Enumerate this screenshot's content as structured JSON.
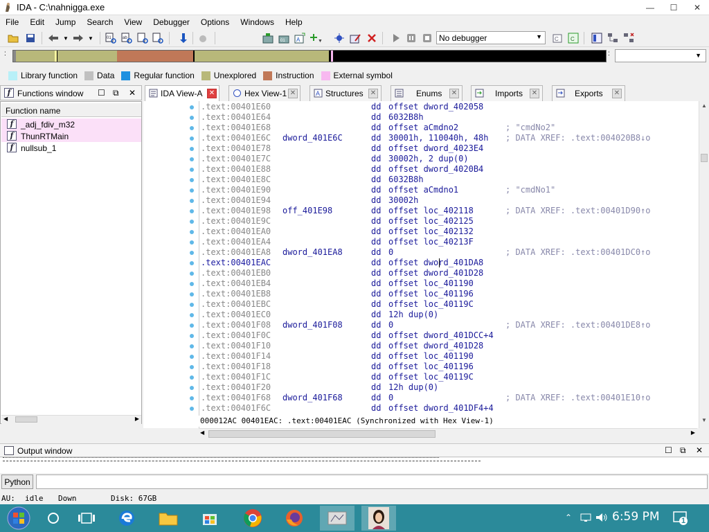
{
  "window": {
    "title": "IDA - C:\\nahnigga.exe"
  },
  "menu": [
    "File",
    "Edit",
    "Jump",
    "Search",
    "View",
    "Debugger",
    "Options",
    "Windows",
    "Help"
  ],
  "toolbar": {
    "debugger_select": "No debugger"
  },
  "legend": [
    {
      "label": "Library function",
      "color": "#b8f0f8"
    },
    {
      "label": "Data",
      "color": "#c0c0c0"
    },
    {
      "label": "Regular function",
      "color": "#1e90e0"
    },
    {
      "label": "Unexplored",
      "color": "#b8b87a"
    },
    {
      "label": "Instruction",
      "color": "#c07858"
    },
    {
      "label": "External symbol",
      "color": "#f8b8f0"
    }
  ],
  "colors": {
    "unexplored": "#b8b87a",
    "instruction": "#c07858",
    "data": "#c0c0c0",
    "external": "#f8b8f0",
    "accent": "#1a1a9a",
    "taskbar": "#2b8a9a"
  },
  "functions_window": {
    "title": "Functions window",
    "column": "Function name",
    "items": [
      "_adj_fdiv_m32",
      "ThunRTMain",
      "nullsub_1"
    ]
  },
  "tabs": [
    {
      "label": "IDA View-A",
      "icon": "ida-view-icon",
      "active": true
    },
    {
      "label": "Hex View-1",
      "icon": "hex-view-icon"
    },
    {
      "label": "Structures",
      "icon": "structures-icon"
    },
    {
      "label": "Enums",
      "icon": "enums-icon"
    },
    {
      "label": "Imports",
      "icon": "imports-icon"
    },
    {
      "label": "Exports",
      "icon": "exports-icon"
    }
  ],
  "disasm": [
    {
      "addr": ".text:00401E60",
      "label": "",
      "op": "dd",
      "arg": "offset dword_402058",
      "cmt": ""
    },
    {
      "addr": ".text:00401E64",
      "label": "",
      "op": "dd",
      "arg": "6032B8h",
      "cmt": ""
    },
    {
      "addr": ".text:00401E68",
      "label": "",
      "op": "dd",
      "arg": "offset aCmdno2",
      "cmt": "; \"cmdNo2\""
    },
    {
      "addr": ".text:00401E6C",
      "label": "dword_401E6C",
      "op": "dd",
      "arg": "30001h, 110040h, 48h",
      "cmt": "; DATA XREF: .text:004020B8↓o"
    },
    {
      "addr": ".text:00401E78",
      "label": "",
      "op": "dd",
      "arg": "offset dword_4023E4",
      "cmt": ""
    },
    {
      "addr": ".text:00401E7C",
      "label": "",
      "op": "dd",
      "arg": "30002h, 2 dup(0)",
      "cmt": ""
    },
    {
      "addr": ".text:00401E88",
      "label": "",
      "op": "dd",
      "arg": "offset dword_4020B4",
      "cmt": ""
    },
    {
      "addr": ".text:00401E8C",
      "label": "",
      "op": "dd",
      "arg": "6032B8h",
      "cmt": ""
    },
    {
      "addr": ".text:00401E90",
      "label": "",
      "op": "dd",
      "arg": "offset aCmdno1",
      "cmt": "; \"cmdNo1\""
    },
    {
      "addr": ".text:00401E94",
      "label": "",
      "op": "dd",
      "arg": "30002h",
      "cmt": ""
    },
    {
      "addr": ".text:00401E98",
      "label": "off_401E98",
      "op": "dd",
      "arg": "offset loc_402118",
      "cmt": "; DATA XREF: .text:00401D90↑o"
    },
    {
      "addr": ".text:00401E9C",
      "label": "",
      "op": "dd",
      "arg": "offset loc_402125",
      "cmt": ""
    },
    {
      "addr": ".text:00401EA0",
      "label": "",
      "op": "dd",
      "arg": "offset loc_402132",
      "cmt": ""
    },
    {
      "addr": ".text:00401EA4",
      "label": "",
      "op": "dd",
      "arg": "offset loc_40213F",
      "cmt": ""
    },
    {
      "addr": ".text:00401EA8",
      "label": "dword_401EA8",
      "op": "dd",
      "arg": "0",
      "cmt": "; DATA XREF: .text:00401DC0↑o"
    },
    {
      "addr": ".text:00401EAC",
      "label": "",
      "op": "dd",
      "arg": "offset dword_401DA8",
      "cmt": "",
      "current": true
    },
    {
      "addr": ".text:00401EB0",
      "label": "",
      "op": "dd",
      "arg": "offset dword_401D28",
      "cmt": ""
    },
    {
      "addr": ".text:00401EB4",
      "label": "",
      "op": "dd",
      "arg": "offset loc_401190",
      "cmt": ""
    },
    {
      "addr": ".text:00401EB8",
      "label": "",
      "op": "dd",
      "arg": "offset loc_401196",
      "cmt": ""
    },
    {
      "addr": ".text:00401EBC",
      "label": "",
      "op": "dd",
      "arg": "offset loc_40119C",
      "cmt": ""
    },
    {
      "addr": ".text:00401EC0",
      "label": "",
      "op": "dd",
      "arg": "12h dup(0)",
      "cmt": ""
    },
    {
      "addr": ".text:00401F08",
      "label": "dword_401F08",
      "op": "dd",
      "arg": "0",
      "cmt": "; DATA XREF: .text:00401DE8↑o"
    },
    {
      "addr": ".text:00401F0C",
      "label": "",
      "op": "dd",
      "arg": "offset dword_401DCC+4",
      "cmt": ""
    },
    {
      "addr": ".text:00401F10",
      "label": "",
      "op": "dd",
      "arg": "offset dword_401D28",
      "cmt": ""
    },
    {
      "addr": ".text:00401F14",
      "label": "",
      "op": "dd",
      "arg": "offset loc_401190",
      "cmt": ""
    },
    {
      "addr": ".text:00401F18",
      "label": "",
      "op": "dd",
      "arg": "offset loc_401196",
      "cmt": ""
    },
    {
      "addr": ".text:00401F1C",
      "label": "",
      "op": "dd",
      "arg": "offset loc_40119C",
      "cmt": ""
    },
    {
      "addr": ".text:00401F20",
      "label": "",
      "op": "dd",
      "arg": "12h dup(0)",
      "cmt": ""
    },
    {
      "addr": ".text:00401F68",
      "label": "dword_401F68",
      "op": "dd",
      "arg": "0",
      "cmt": "; DATA XREF: .text:00401E10↑o"
    },
    {
      "addr": ".text:00401F6C",
      "label": "",
      "op": "dd",
      "arg": "offset dword_401DF4+4",
      "cmt": ""
    }
  ],
  "disasm_status": "000012AC 00401EAC: .text:00401EAC (Synchronized with Hex View-1)",
  "output": {
    "title": "Output window",
    "python_button": "Python"
  },
  "status": {
    "au_label": "AU:",
    "au": "idle",
    "direction": "Down",
    "disk": "Disk: 67GB"
  },
  "taskbar": {
    "clock": "6:59 PM",
    "notifications": "1"
  }
}
